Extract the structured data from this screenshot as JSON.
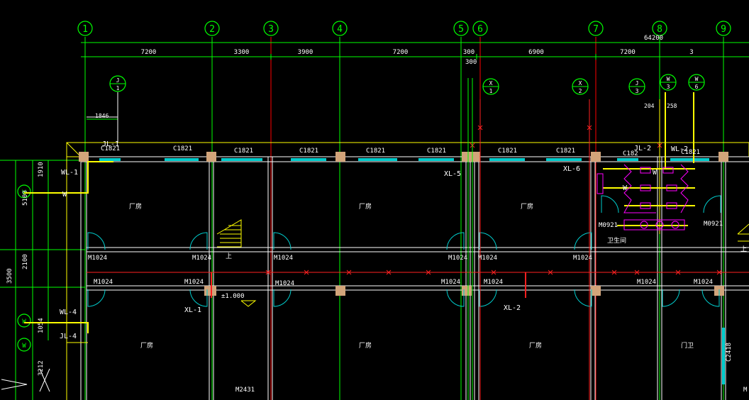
{
  "drawing": {
    "background": "#000000",
    "colors": {
      "axis": "#00ff00",
      "dimension": "#00ff00",
      "wall": "#ffffff",
      "column": "#d2a47a",
      "window": "#00cccc",
      "pipe": "#ff2020",
      "waterline": "#ffff00",
      "fixture": "#ff00ff",
      "grid_red": "#ff0000",
      "label": "#ffffff"
    }
  },
  "axes": [
    "1",
    "2",
    "3",
    "4",
    "5",
    "6",
    "7",
    "8",
    "9"
  ],
  "side_axes": [
    "W",
    "W",
    "W"
  ],
  "dimensions": {
    "total": "64200",
    "spans": [
      "7200",
      "3300",
      "3900",
      "7200",
      "300",
      "6900",
      "7200",
      "3"
    ],
    "sub": "300",
    "small": [
      "1846",
      "204",
      "258"
    ],
    "left": [
      "1910",
      "5100",
      "2100",
      "3500",
      "1054",
      "3212"
    ]
  },
  "markers": [
    {
      "top": "J",
      "bottom": "1"
    },
    {
      "top": "X",
      "bottom": "1"
    },
    {
      "top": "X",
      "bottom": "2"
    },
    {
      "top": "J",
      "bottom": "3"
    },
    {
      "top": "W",
      "bottom": "3"
    },
    {
      "top": "W",
      "bottom": "6"
    }
  ],
  "windows": [
    "C1821",
    "C1821",
    "C1821",
    "C1821",
    "C1821",
    "C1821",
    "C1821",
    "C1821",
    "C182",
    "C2418",
    "C1821"
  ],
  "doors": [
    "M1024",
    "M1024",
    "M1024",
    "M1024",
    "M1024",
    "M1024",
    "M1024",
    "M1024",
    "M1024",
    "M1024",
    "M1024",
    "M1024",
    "M1024",
    "M1024",
    "M0921",
    "M0921",
    "M2431",
    "M"
  ],
  "pipe_labels": [
    "JL-1",
    "WL-1",
    "XL-5",
    "XL-6",
    "JL-2",
    "WL-2",
    "WL-4",
    "JL-4",
    "XL-1",
    "XL-2",
    "W",
    "W",
    "W"
  ],
  "rooms": [
    "厂房",
    "厂房",
    "厂房",
    "厂房",
    "厂房",
    "厂房",
    "门卫",
    "卫生间"
  ],
  "stair_text": [
    "上",
    "上"
  ],
  "elevation": "±1.000"
}
